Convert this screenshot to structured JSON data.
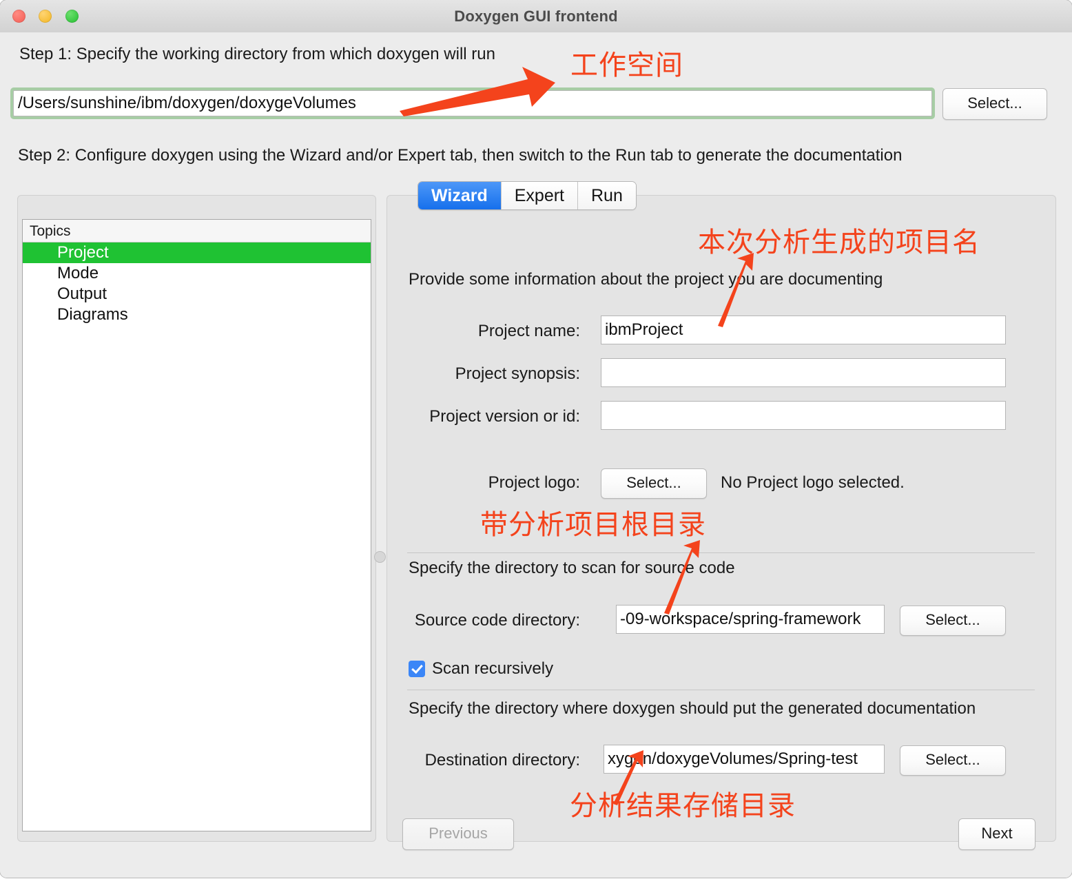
{
  "window": {
    "title": "Doxygen GUI frontend",
    "traffic_lights": [
      "close",
      "minimize",
      "maximize"
    ]
  },
  "step1": {
    "label": "Step 1: Specify the working directory from which doxygen will run",
    "working_directory": "/Users/sunshine/ibm/doxygen/doxygeVolumes",
    "select_button": "Select..."
  },
  "step2": {
    "label": "Step 2: Configure doxygen using the Wizard and/or Expert tab, then switch to the Run tab to generate the documentation"
  },
  "topics": {
    "header": "Topics",
    "items": [
      {
        "label": "Project",
        "selected": true
      },
      {
        "label": "Mode",
        "selected": false
      },
      {
        "label": "Output",
        "selected": false
      },
      {
        "label": "Diagrams",
        "selected": false
      }
    ]
  },
  "tabs": [
    {
      "label": "Wizard",
      "active": true
    },
    {
      "label": "Expert",
      "active": false
    },
    {
      "label": "Run",
      "active": false
    }
  ],
  "wizard": {
    "intro": "Provide some information about the project you are documenting",
    "project_name_label": "Project name:",
    "project_name_value": "ibmProject",
    "project_synopsis_label": "Project synopsis:",
    "project_synopsis_value": "",
    "project_version_label": "Project version or id:",
    "project_version_value": "",
    "project_logo_label": "Project logo:",
    "project_logo_button": "Select...",
    "project_logo_status": "No Project logo selected.",
    "source_section_label": "Specify the directory to scan for source code",
    "source_dir_label": "Source code directory:",
    "source_dir_value": "-09-workspace/spring-framework",
    "source_dir_button": "Select...",
    "scan_recursively_label": "Scan recursively",
    "scan_recursively_checked": true,
    "dest_section_label": "Specify the directory where doxygen should put the generated documentation",
    "dest_dir_label": "Destination directory:",
    "dest_dir_value": "xygen/doxygeVolumes/Spring-test",
    "dest_dir_button": "Select...",
    "previous_button": "Previous",
    "next_button": "Next"
  },
  "annotations": {
    "workspace": "工作空间",
    "project_name": "本次分析生成的项目名",
    "source_root": "带分析项目根目录",
    "result_store": "分析结果存储目录"
  },
  "colors": {
    "accent_blue": "#1670ec",
    "selection_green": "#1fc233",
    "focus_green": "#a7cda5",
    "annotation_red": "#f4431c",
    "checkbox_blue": "#3b86f7"
  }
}
